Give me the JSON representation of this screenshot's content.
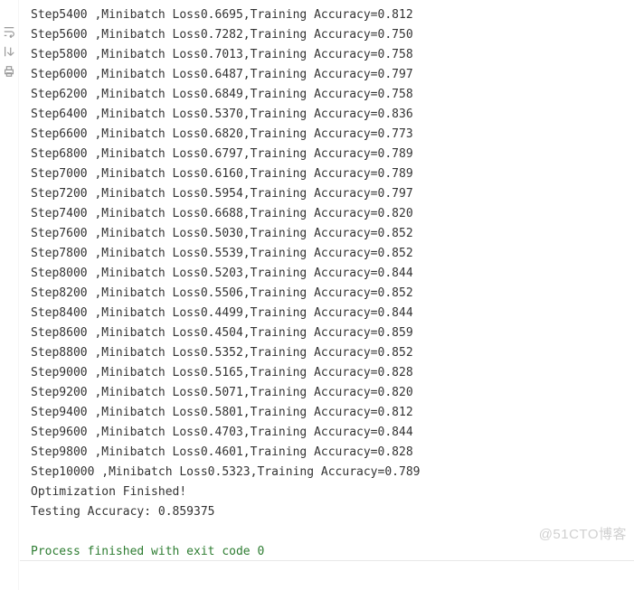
{
  "log": {
    "rows": [
      {
        "step": "5400",
        "loss": "0.6695",
        "acc": "0.812"
      },
      {
        "step": "5600",
        "loss": "0.7282",
        "acc": "0.750"
      },
      {
        "step": "5800",
        "loss": "0.7013",
        "acc": "0.758"
      },
      {
        "step": "6000",
        "loss": "0.6487",
        "acc": "0.797"
      },
      {
        "step": "6200",
        "loss": "0.6849",
        "acc": "0.758"
      },
      {
        "step": "6400",
        "loss": "0.5370",
        "acc": "0.836"
      },
      {
        "step": "6600",
        "loss": "0.6820",
        "acc": "0.773"
      },
      {
        "step": "6800",
        "loss": "0.6797",
        "acc": "0.789"
      },
      {
        "step": "7000",
        "loss": "0.6160",
        "acc": "0.789"
      },
      {
        "step": "7200",
        "loss": "0.5954",
        "acc": "0.797"
      },
      {
        "step": "7400",
        "loss": "0.6688",
        "acc": "0.820"
      },
      {
        "step": "7600",
        "loss": "0.5030",
        "acc": "0.852"
      },
      {
        "step": "7800",
        "loss": "0.5539",
        "acc": "0.852"
      },
      {
        "step": "8000",
        "loss": "0.5203",
        "acc": "0.844"
      },
      {
        "step": "8200",
        "loss": "0.5506",
        "acc": "0.852"
      },
      {
        "step": "8400",
        "loss": "0.4499",
        "acc": "0.844"
      },
      {
        "step": "8600",
        "loss": "0.4504",
        "acc": "0.859"
      },
      {
        "step": "8800",
        "loss": "0.5352",
        "acc": "0.852"
      },
      {
        "step": "9000",
        "loss": "0.5165",
        "acc": "0.828"
      },
      {
        "step": "9200",
        "loss": "0.5071",
        "acc": "0.820"
      },
      {
        "step": "9400",
        "loss": "0.5801",
        "acc": "0.812"
      },
      {
        "step": "9600",
        "loss": "0.4703",
        "acc": "0.844"
      },
      {
        "step": "9800",
        "loss": "0.4601",
        "acc": "0.828"
      },
      {
        "step": "10000",
        "loss": "0.5323",
        "acc": "0.789"
      }
    ],
    "step_prefix": "Step",
    "loss_prefix": "Minibatch Loss",
    "acc_prefix": "Training Accuracy=",
    "done_msg": "Optimization Finished!",
    "test_msg": "Testing Accuracy: 0.859375",
    "exit_msg": "Process finished with exit code 0"
  },
  "watermark": "@51CTO博客",
  "gutter": {
    "wrap_icon": "wrap-text-icon",
    "scroll_icon": "scroll-to-end-icon",
    "print_icon": "print-icon"
  },
  "colors": {
    "text": "#333333",
    "exit_message": "#2e7d32",
    "gutter_icon": "#9b9b9b",
    "watermark": "#d0d0d0"
  }
}
